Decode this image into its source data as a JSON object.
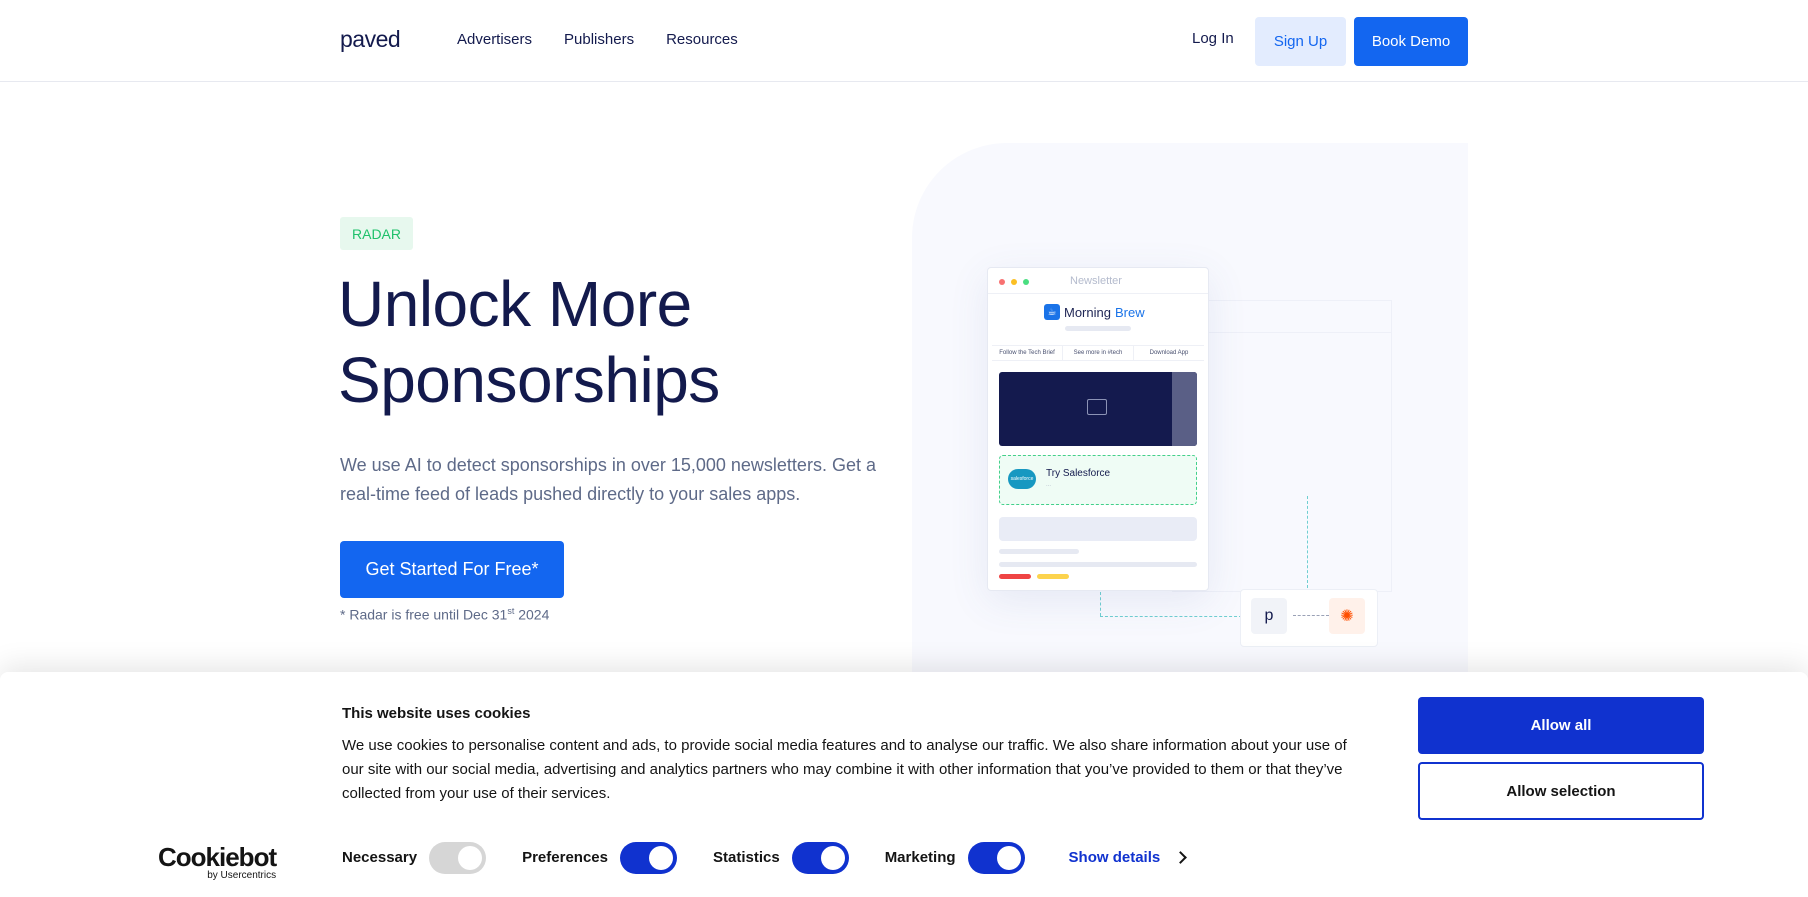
{
  "header": {
    "logo": "paved",
    "nav": [
      "Advertisers",
      "Publishers",
      "Resources"
    ],
    "login": "Log In",
    "signup": "Sign Up",
    "book_demo": "Book Demo"
  },
  "hero": {
    "badge": "RADAR",
    "title_line1": "Unlock More",
    "title_line2": "Sponsorships",
    "description": "We use AI to detect sponsorships in over 15,000 newsletters. Get a real-time feed of leads pushed directly to your sales apps.",
    "cta": "Get Started For Free*",
    "note_prefix": "* Radar is free until Dec 31",
    "note_sup": "st",
    "note_suffix": " 2024"
  },
  "illustration": {
    "window_title": "Newsletter",
    "brand_part1": "Morning",
    "brand_part2": "Brew",
    "links": [
      "Follow the Tech Brief",
      "See more in #tech",
      "Download App"
    ],
    "sponsor_label": "Try Salesforce",
    "sponsor_logo_text": "salesforce",
    "sponsor_sub": "...",
    "integration_left": "p",
    "integration_right": "✺"
  },
  "cookie": {
    "title": "This website uses cookies",
    "text": "We use cookies to personalise content and ads, to provide social media features and to analyse our traffic. We also share information about your use of our site with our social media, advertising and analytics partners who may combine it with other information that you’ve provided to them or that they’ve collected from your use of their services.",
    "logo_main": "Cookiebot",
    "logo_by": "by Usercentrics",
    "toggles": [
      {
        "label": "Necessary",
        "enabled": true,
        "disabled": true
      },
      {
        "label": "Preferences",
        "enabled": true,
        "disabled": false
      },
      {
        "label": "Statistics",
        "enabled": true,
        "disabled": false
      },
      {
        "label": "Marketing",
        "enabled": true,
        "disabled": false
      }
    ],
    "show_details": "Show details",
    "allow_all": "Allow all",
    "allow_selection": "Allow selection"
  },
  "colors": {
    "primary": "#1366f0",
    "navy": "#131a4d",
    "cookie_blue": "#1032cf",
    "badge_green": "#1fc16b"
  }
}
